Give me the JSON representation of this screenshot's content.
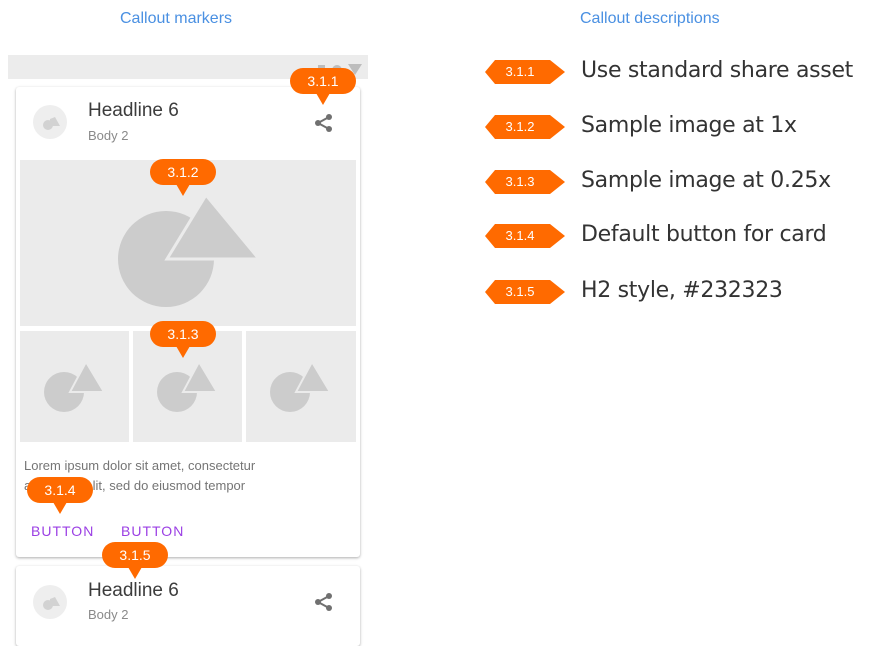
{
  "left_title": "Callout markers",
  "right_title": "Callout descriptions",
  "card1": {
    "headline": "Headline 6",
    "body": "Body 2",
    "text_line1": "Lorem ipsum dolor sit amet, consectetur",
    "text_line2": "adipiscing elit, sed do eiusmod tempor",
    "button1": "BUTTON",
    "button2": "BUTTON"
  },
  "card2": {
    "headline": "Headline 6",
    "body": "Body 2"
  },
  "markers": [
    "3.1.1",
    "3.1.2",
    "3.1.3",
    "3.1.4",
    "3.1.5"
  ],
  "descriptions": [
    {
      "id": "3.1.1",
      "text": "Use standard share asset"
    },
    {
      "id": "3.1.2",
      "text": "Sample image at 1x"
    },
    {
      "id": "3.1.3",
      "text": "Sample image at 0.25x"
    },
    {
      "id": "3.1.4",
      "text": "Default button for card"
    },
    {
      "id": "3.1.5",
      "text": "H2 style, #232323"
    }
  ],
  "colors": {
    "marker": "#ff6a00",
    "title": "#4a90e2",
    "button": "#9b3fe4",
    "placeholder": "#ebebeb",
    "shape": "#cccccc"
  },
  "icons": {
    "share": "share-icon",
    "avatar": "avatar-placeholder-icon",
    "image": "image-placeholder-icon"
  }
}
